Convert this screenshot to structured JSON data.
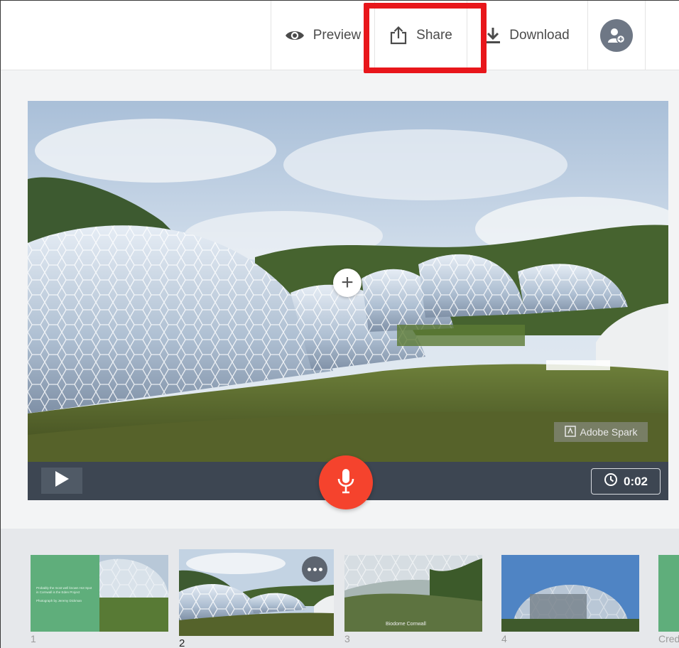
{
  "toolbar": {
    "preview_label": "Preview",
    "share_label": "Share",
    "download_label": "Download"
  },
  "stage": {
    "add_symbol": "+",
    "watermark": "Adobe Spark"
  },
  "player": {
    "duration": "0:02"
  },
  "filmstrip": {
    "slides": [
      {
        "number": "1",
        "caption_line1": "Probably the most well known Hot Spot",
        "caption_line2": "in Cornwall is the Eden Project",
        "caption_line3": "Photograph by Jeremy Dickman"
      },
      {
        "number": "2"
      },
      {
        "number": "3",
        "caption": "Biodome Cornwall"
      },
      {
        "number": "4"
      },
      {
        "number": "Cred"
      }
    ]
  },
  "colors": {
    "accent_red": "#f5432d",
    "highlight": "#e8161b",
    "control_bar": "#3d4652",
    "slide_green": "#5fae7b"
  },
  "icons": [
    "eye-icon",
    "share-icon",
    "download-icon",
    "add-collaborator-icon",
    "plus-icon",
    "play-icon",
    "microphone-icon",
    "clock-icon",
    "more-icon"
  ]
}
